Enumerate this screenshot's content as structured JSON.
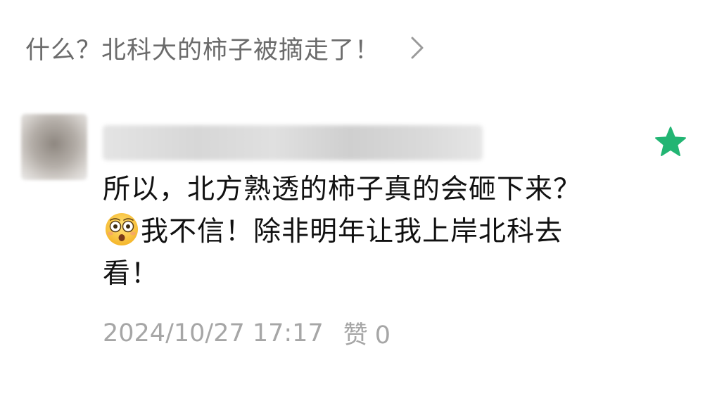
{
  "article": {
    "title": "什么？北科大的柿子被摘走了！",
    "chevron_icon": "chevron-right-icon"
  },
  "comment": {
    "avatar_icon": "user-avatar",
    "username": "",
    "star_icon": "star-icon",
    "star_color": "#22b573",
    "body_part1": "所以，北方熟透的柿子真的会砸下来？",
    "emoji_icon": "flushed-face-emoji",
    "body_part2": "我不信！除非明年让我上岸北科去看！",
    "timestamp": "2024/10/27 17:17",
    "like_label": "赞",
    "like_count": "0"
  },
  "colors": {
    "title_gray": "#6b6b6b",
    "meta_gray": "#a6a6a6",
    "text": "#111111",
    "accent_green": "#22b573"
  }
}
